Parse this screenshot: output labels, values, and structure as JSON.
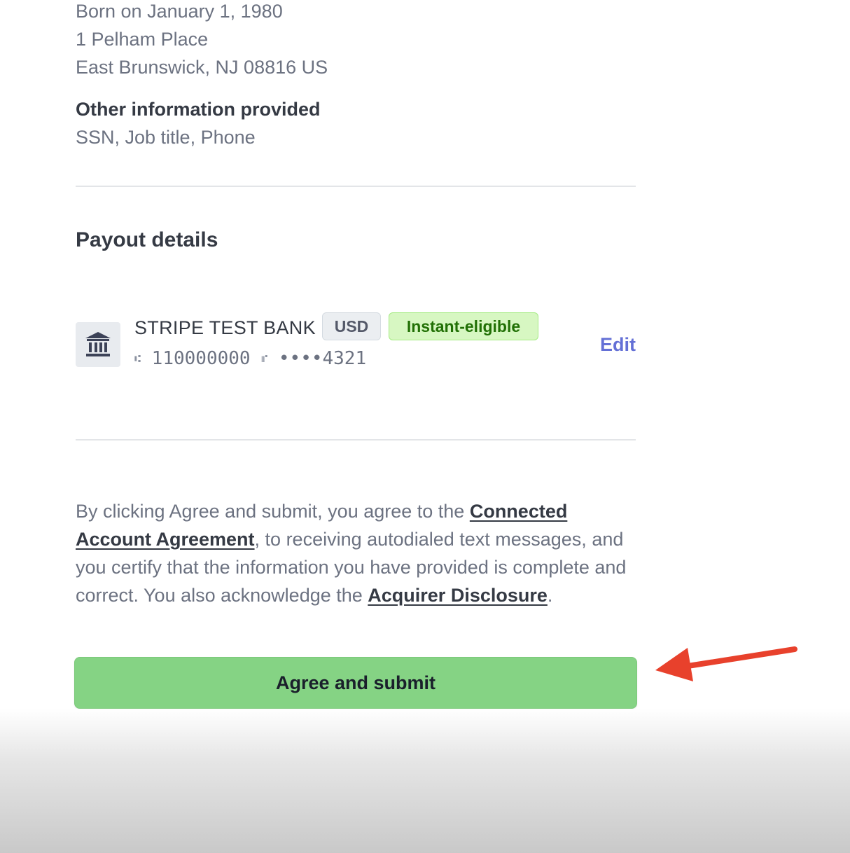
{
  "identity": {
    "address_lines": [
      "Born on January 1, 1980",
      "1 Pelham Place",
      "East Brunswick, NJ 08816 US"
    ],
    "other_label": "Other information provided",
    "other_value": "SSN, Job title, Phone"
  },
  "payout": {
    "title": "Payout details",
    "bank_name": "STRIPE TEST BANK",
    "currency_badge": "USD",
    "instant_badge": "Instant-eligible",
    "routing_number": "110000000",
    "account_number": "••••4321",
    "edit_label": "Edit"
  },
  "legal": {
    "before_link1": "By clicking Agree and submit, you agree to the ",
    "link1": "Connected Account Agreement",
    "middle": ", to receiving autodialed text messages, and you certify that the information you have provided is complete and correct. You also acknowledge the ",
    "link2": "Acquirer Disclosure",
    "after": "."
  },
  "submit": {
    "label": "Agree and submit"
  },
  "colors": {
    "submit_bg": "#85d384",
    "link": "#6470d6",
    "instant_badge_bg": "#d7f7c2",
    "arrow": "#e8412c"
  },
  "icons": {
    "bank": "bank-icon",
    "annotation": "red-arrow-icon"
  }
}
